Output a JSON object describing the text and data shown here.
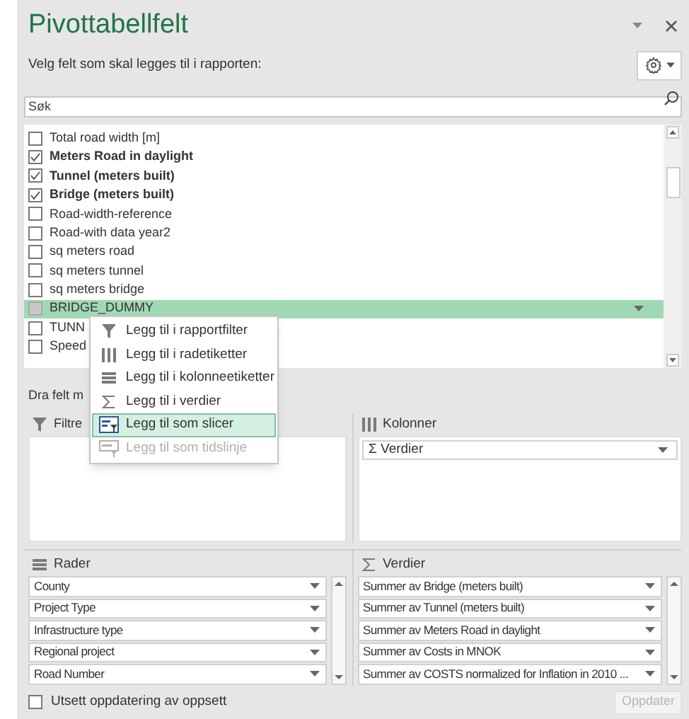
{
  "panel": {
    "title": "Pivottabellfelt",
    "subtitle": "Velg felt som skal legges til i rapporten:"
  },
  "search": {
    "placeholder": "Søk"
  },
  "fields": [
    {
      "label": "Total road width [m]",
      "checked": false,
      "selected": false
    },
    {
      "label": "Meters Road in daylight",
      "checked": true,
      "selected": false
    },
    {
      "label": "Tunnel (meters built)",
      "checked": true,
      "selected": false
    },
    {
      "label": "Bridge (meters built)",
      "checked": true,
      "selected": false
    },
    {
      "label": "Road-width-reference",
      "checked": false,
      "selected": false
    },
    {
      "label": "Road-with data year2",
      "checked": false,
      "selected": false
    },
    {
      "label": "sq meters road",
      "checked": false,
      "selected": false
    },
    {
      "label": "sq meters tunnel",
      "checked": false,
      "selected": false
    },
    {
      "label": "sq meters bridge",
      "checked": false,
      "selected": false
    },
    {
      "label": "BRIDGE_DUMMY",
      "checked": false,
      "selected": true
    },
    {
      "label": "TUNN",
      "checked": false,
      "selected": false
    },
    {
      "label": "Speed",
      "checked": false,
      "selected": false
    }
  ],
  "context_menu": {
    "items": [
      {
        "label": "Legg til i rapportfilter",
        "selected": false,
        "disabled": false
      },
      {
        "label": "Legg til i radetiketter",
        "selected": false,
        "disabled": false
      },
      {
        "label": "Legg til i kolonneetiketter",
        "selected": false,
        "disabled": false
      },
      {
        "label": "Legg til i verdier",
        "selected": false,
        "disabled": false
      },
      {
        "label": "Legg til som slicer",
        "selected": true,
        "disabled": false
      },
      {
        "label": "Legg til som tidslinje",
        "selected": false,
        "disabled": true
      }
    ]
  },
  "areas_hint": "Dra felt m",
  "areas": {
    "filters": {
      "title": "Filtre"
    },
    "columns": {
      "title": "Kolonner",
      "items": [
        "Σ Verdier"
      ]
    },
    "rows": {
      "title": "Rader",
      "items": [
        "County",
        "Project Type",
        "Infrastructure type",
        "Regional project",
        "Road Number"
      ]
    },
    "values": {
      "title": "Verdier",
      "items": [
        "Summer av Bridge (meters built)",
        "Summer av Tunnel (meters built)",
        "Summer av Meters Road in daylight",
        "Summer av Costs in MNOK",
        "Summer av COSTS normalized for Inflation in 2010 ..."
      ]
    }
  },
  "defer": {
    "label": "Utsett oppdatering av oppsett",
    "checked": false
  },
  "update_button": {
    "label": "Oppdater",
    "disabled": true
  }
}
